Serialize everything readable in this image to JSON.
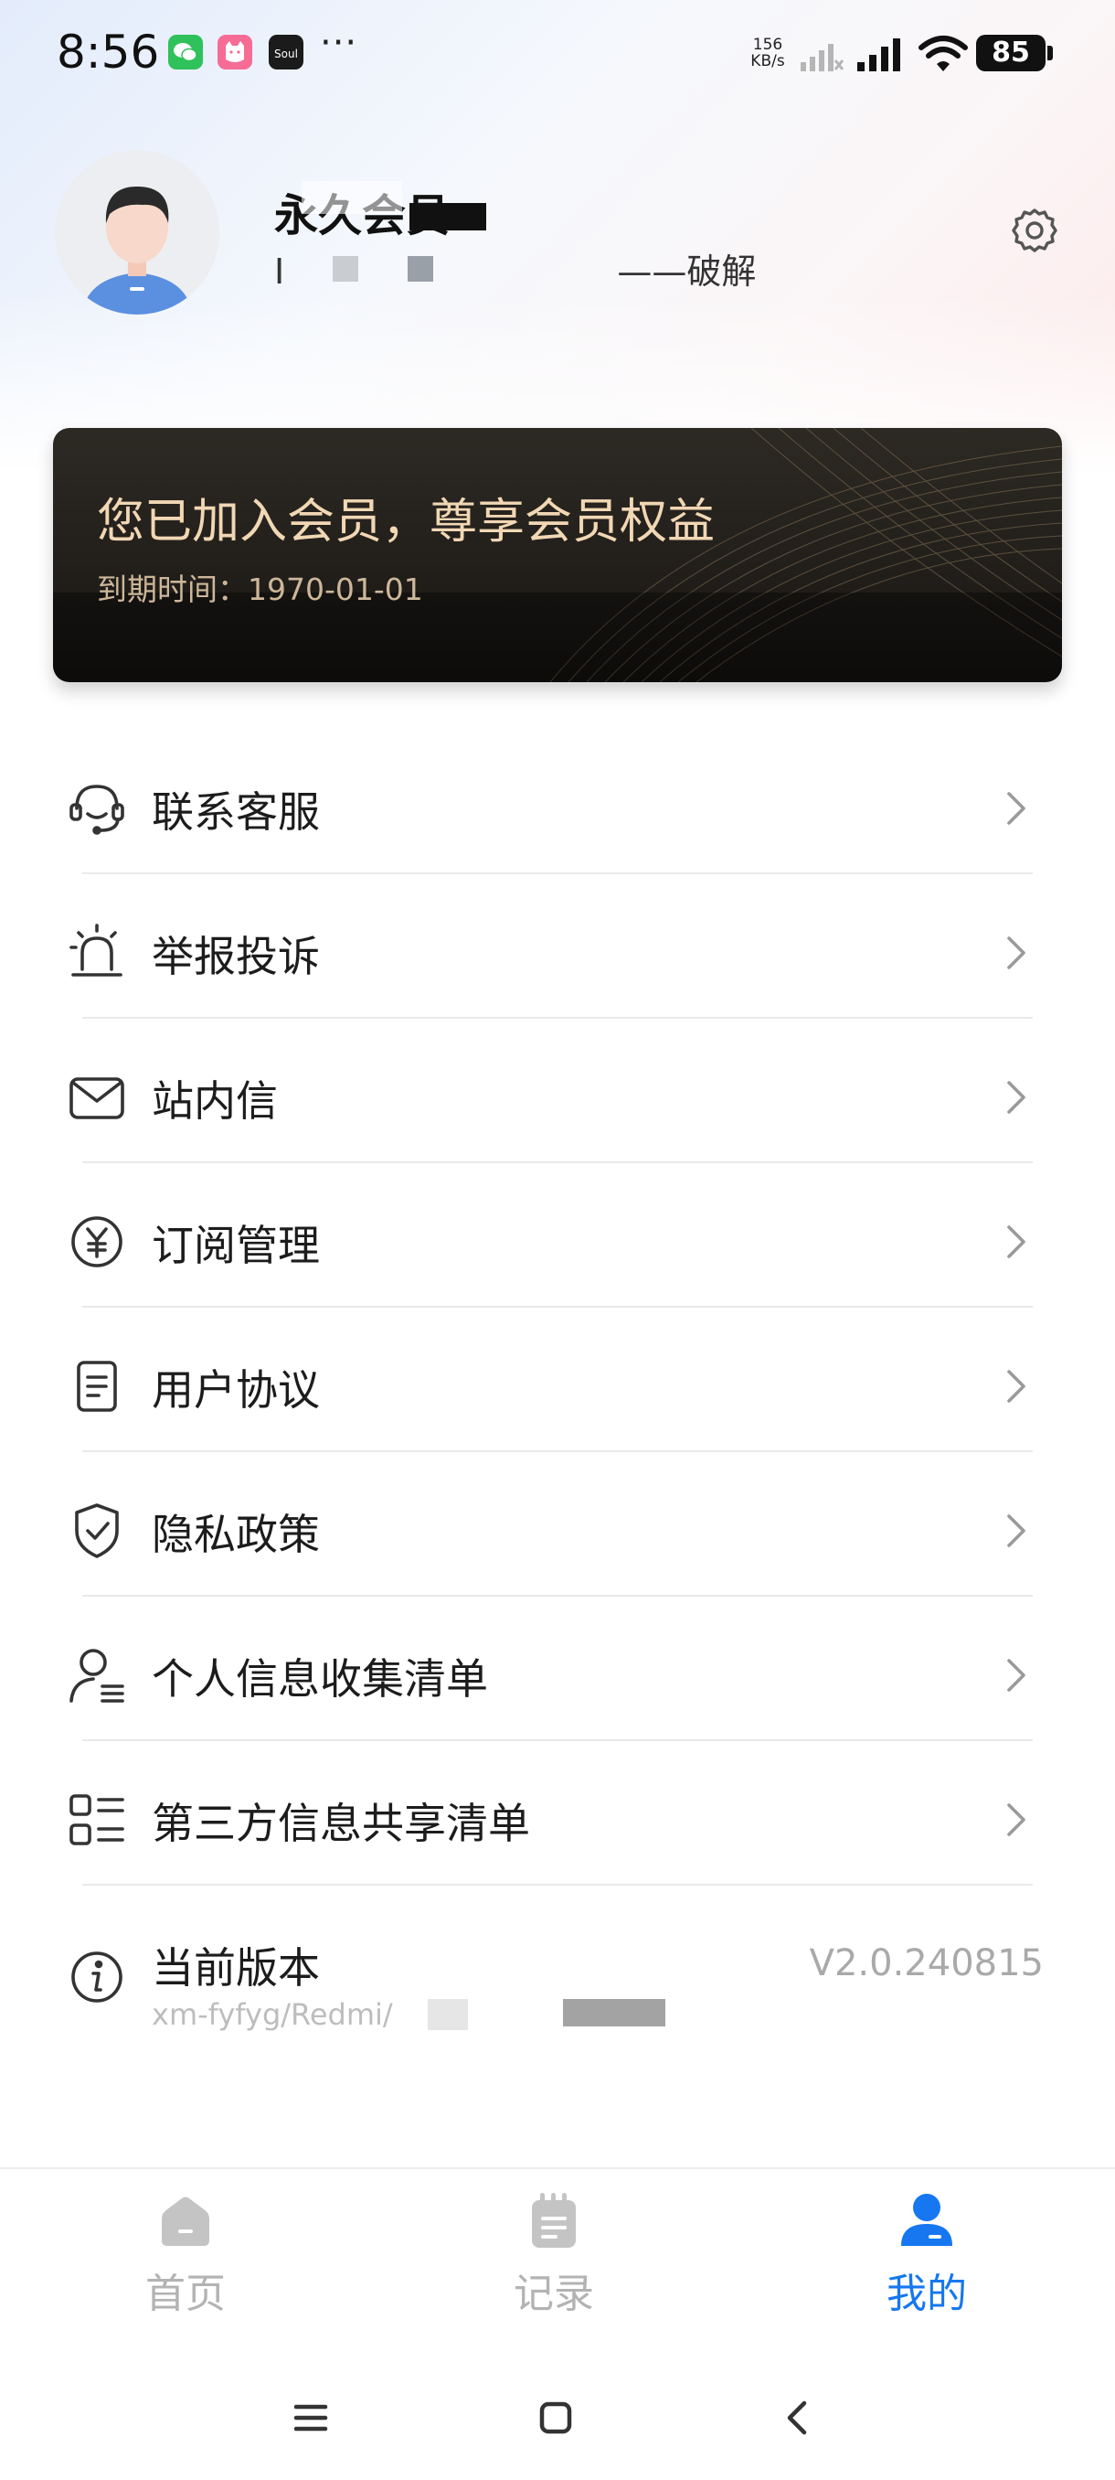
{
  "status_bar": {
    "time": "8:56",
    "more": "···",
    "net_speed_value": "156",
    "net_speed_unit": "KB/s",
    "battery": "85",
    "apps": [
      "wechat-icon",
      "cat-app-icon",
      "soul-app-icon"
    ],
    "soul_label": "Soul"
  },
  "profile": {
    "name": "永久会员",
    "subtitle_prefix": "I",
    "subtitle_suffix": "——破解"
  },
  "member_card": {
    "title": "您已加入会员，尊享会员权益",
    "expire": "到期时间：1970-01-01"
  },
  "menu": {
    "items": [
      {
        "label": "联系客服",
        "icon": "headset-icon"
      },
      {
        "label": "举报投诉",
        "icon": "alarm-icon"
      },
      {
        "label": "站内信",
        "icon": "mail-icon"
      },
      {
        "label": "订阅管理",
        "icon": "yen-circle-icon"
      },
      {
        "label": "用户协议",
        "icon": "document-icon"
      },
      {
        "label": "隐私政策",
        "icon": "shield-check-icon"
      },
      {
        "label": "个人信息收集清单",
        "icon": "user-list-icon"
      },
      {
        "label": "第三方信息共享清单",
        "icon": "grid-list-icon"
      }
    ],
    "version": {
      "label": "当前版本",
      "sub": "xm-fyfyg/Redmi/",
      "value": "V2.0.240815",
      "icon": "info-icon"
    }
  },
  "tabbar": {
    "tabs": [
      {
        "label": "首页",
        "icon": "home-icon"
      },
      {
        "label": "记录",
        "icon": "notebook-icon"
      },
      {
        "label": "我的",
        "icon": "person-icon"
      }
    ],
    "active_color": "#1677f0",
    "inactive_color": "#b3b3b3"
  },
  "colors": {
    "card_title": "#f1d7b4",
    "card_bg": "#221f1b"
  }
}
